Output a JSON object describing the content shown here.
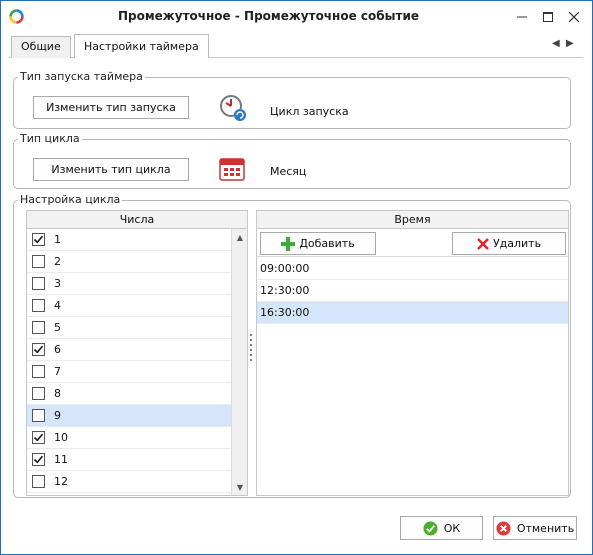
{
  "window": {
    "title": "Промежуточное - Промежуточное событие"
  },
  "tabs": [
    {
      "label": "Общие"
    },
    {
      "label": "Настройки таймера"
    }
  ],
  "launch_group": {
    "title": "Тип запуска таймера",
    "button_label": "Изменить тип запуска",
    "value": "Цикл запуска"
  },
  "cycle_group": {
    "title": "Тип цикла",
    "button_label": "Изменить тип цикла",
    "value": "Месяц"
  },
  "setup_group": {
    "title": "Настройка цикла",
    "numbers_header": "Числа",
    "time_header": "Время",
    "add_label": "Добавить",
    "delete_label": "Удалить",
    "numbers": [
      {
        "label": "1",
        "checked": true
      },
      {
        "label": "2",
        "checked": false
      },
      {
        "label": "3",
        "checked": false
      },
      {
        "label": "4",
        "checked": false
      },
      {
        "label": "5",
        "checked": false
      },
      {
        "label": "6",
        "checked": true
      },
      {
        "label": "7",
        "checked": false
      },
      {
        "label": "8",
        "checked": false
      },
      {
        "label": "9",
        "checked": false,
        "selected": true
      },
      {
        "label": "10",
        "checked": true
      },
      {
        "label": "11",
        "checked": true
      },
      {
        "label": "12",
        "checked": false
      }
    ],
    "times": [
      {
        "label": "09:00:00"
      },
      {
        "label": "12:30:00"
      },
      {
        "label": "16:30:00",
        "selected": true
      }
    ]
  },
  "footer": {
    "ok_label": "ОК",
    "cancel_label": "Отменить"
  },
  "colors": {
    "accent": "#1f6fb8",
    "selection": "#d6e6fa",
    "add_icon": "#3cae3c",
    "delete_icon": "#e0262c",
    "ok_icon": "#4caf2c",
    "cancel_icon": "#e03a3a"
  }
}
